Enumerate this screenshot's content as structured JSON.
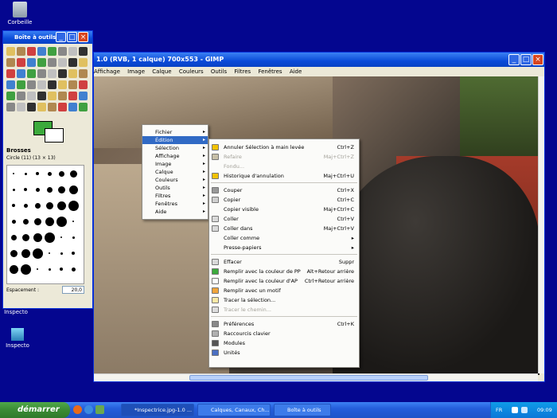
{
  "desktop": {
    "recycle_label": "Corbeille",
    "inspect1_label": "Inspecto",
    "inspect2_label": "Inspecto",
    "docs_label": "inspecto"
  },
  "gimp": {
    "title": "1.0 (RVB, 1 calque) 700x553 - GIMP",
    "menus": [
      "Affichage",
      "Image",
      "Calque",
      "Couleurs",
      "Outils",
      "Filtres",
      "Fenêtres",
      "Aide"
    ]
  },
  "toolbox": {
    "title": "Boîte à outils",
    "brushes_header": "Brosses",
    "brush_name": "Circle (11) (13 × 13)",
    "spacing_label": "Espacement :",
    "spacing_value": "20,0"
  },
  "context_menu": {
    "items": [
      "Fichier",
      "Édition",
      "Sélection",
      "Affichage",
      "Image",
      "Calque",
      "Couleurs",
      "Outils",
      "Filtres",
      "Fenêtres",
      "Aide"
    ]
  },
  "edit_submenu": {
    "items": [
      {
        "label": "Annuler Sélection à main levée",
        "shortcut": "Ctrl+Z"
      },
      {
        "label": "Refaire",
        "shortcut": "Maj+Ctrl+Z"
      },
      {
        "label": "Fondu...",
        "shortcut": ""
      },
      {
        "label": "Historique d'annulation",
        "shortcut": "Maj+Ctrl+U"
      },
      {
        "label": "Couper",
        "shortcut": "Ctrl+X"
      },
      {
        "label": "Copier",
        "shortcut": "Ctrl+C"
      },
      {
        "label": "Copier visible",
        "shortcut": "Maj+Ctrl+C"
      },
      {
        "label": "Coller",
        "shortcut": "Ctrl+V"
      },
      {
        "label": "Coller dans",
        "shortcut": "Maj+Ctrl+V"
      },
      {
        "label": "Coller comme",
        "shortcut": ""
      },
      {
        "label": "Presse-papiers",
        "shortcut": ""
      },
      {
        "label": "Effacer",
        "shortcut": "Suppr"
      },
      {
        "label": "Remplir avec la couleur de PP",
        "shortcut": "Alt+Retour arrière"
      },
      {
        "label": "Remplir avec la couleur d'AP",
        "shortcut": "Ctrl+Retour arrière"
      },
      {
        "label": "Remplir avec un motif",
        "shortcut": ""
      },
      {
        "label": "Tracer la sélection...",
        "shortcut": ""
      },
      {
        "label": "Tracer le chemin...",
        "shortcut": ""
      },
      {
        "label": "Préférences",
        "shortcut": "Ctrl+K"
      },
      {
        "label": "Raccourcis clavier",
        "shortcut": ""
      },
      {
        "label": "Modules",
        "shortcut": ""
      },
      {
        "label": "Unités",
        "shortcut": ""
      }
    ]
  },
  "taskbar": {
    "start_label": "démarrer",
    "tasks": [
      "*Inspectrice.jpg-1.0 ...",
      "Calques, Canaux, Ch...",
      "Boîte à outils"
    ],
    "lang": "FR",
    "clock": "09:09"
  },
  "colors": {
    "desktop": "#04068f",
    "title_blue": "#0a4ad8",
    "fg_color": "#3caa3c",
    "menu_highlight": "#316ac5"
  }
}
